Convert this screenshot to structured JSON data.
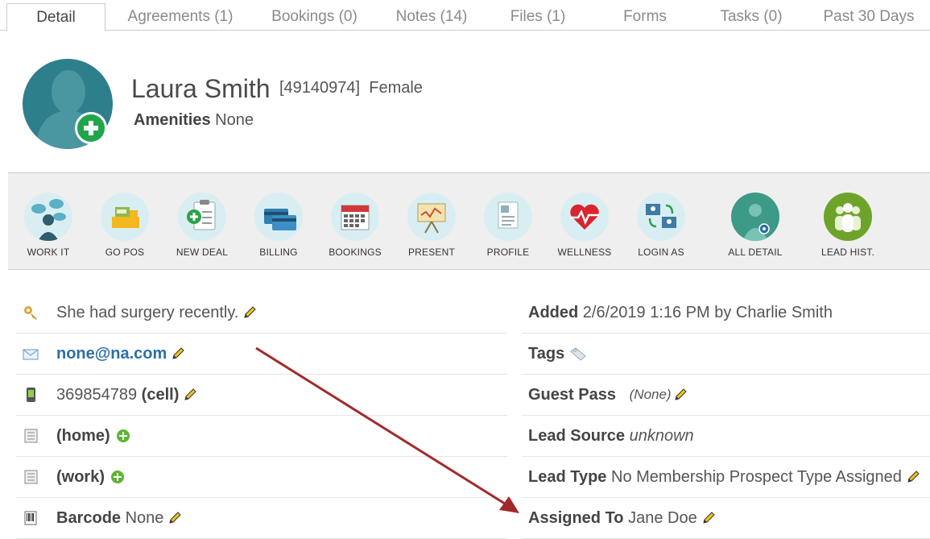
{
  "tabs": [
    {
      "label": "Detail"
    },
    {
      "label": "Agreements (1)"
    },
    {
      "label": "Bookings (0)"
    },
    {
      "label": "Notes (14)"
    },
    {
      "label": "Files (1)"
    },
    {
      "label": "Forms"
    },
    {
      "label": "Tasks (0)"
    },
    {
      "label": "Past 30 Days"
    }
  ],
  "person": {
    "name": "Laura Smith",
    "id": "[49140974]",
    "gender": "Female",
    "amenities_label": "Amenities",
    "amenities_value": "None"
  },
  "toolbar": [
    {
      "label": "WORK IT",
      "icon": "chat-person-icon"
    },
    {
      "label": "GO POS",
      "icon": "cash-register-icon"
    },
    {
      "label": "NEW DEAL",
      "icon": "clipboard-plus-icon"
    },
    {
      "label": "BILLING",
      "icon": "credit-card-icon"
    },
    {
      "label": "BOOKINGS",
      "icon": "calendar-icon"
    },
    {
      "label": "PRESENT",
      "icon": "presentation-board-icon"
    },
    {
      "label": "PROFILE",
      "icon": "profile-document-icon"
    },
    {
      "label": "WELLNESS",
      "icon": "heartbeat-icon"
    },
    {
      "label": "LOGIN AS",
      "icon": "switch-user-icon"
    },
    {
      "label": "ALL DETAIL",
      "icon": "person-gear-icon"
    },
    {
      "label": "LEAD HIST.",
      "icon": "group-icon"
    }
  ],
  "left": {
    "note": "She had surgery recently.",
    "email": "none@na.com",
    "phone_number": "369854789",
    "phone_type": "(cell)",
    "home_label": "(home)",
    "work_label": "(work)",
    "barcode_label": "Barcode",
    "barcode_value": "None"
  },
  "right": {
    "added_label": "Added",
    "added_value": "2/6/2019 1:16 PM by Charlie Smith",
    "tags_label": "Tags",
    "guest_pass_label": "Guest Pass",
    "guest_pass_value": "(None)",
    "lead_source_label": "Lead Source",
    "lead_source_value": "unknown",
    "lead_type_label": "Lead Type",
    "lead_type_value": "No Membership Prospect Type Assigned",
    "assigned_label": "Assigned To",
    "assigned_value": "Jane Doe"
  },
  "colors": {
    "accent_teal": "#2d7f8c",
    "add_green": "#20a54a",
    "link_blue": "#2a6fa8",
    "annotation_arrow": "#a3282b"
  }
}
